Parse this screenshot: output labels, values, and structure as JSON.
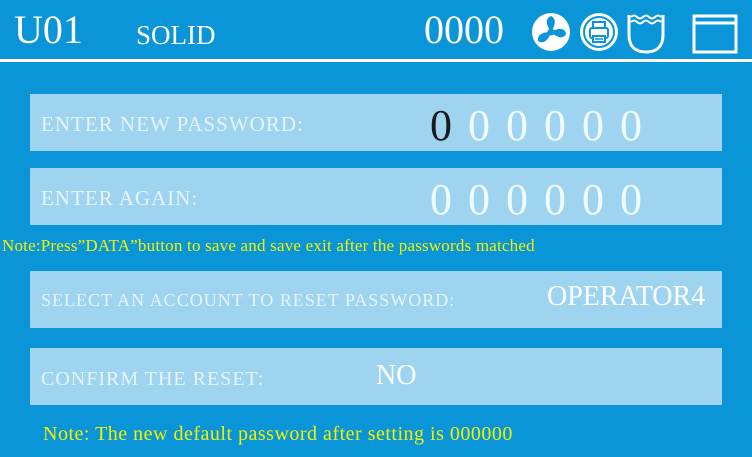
{
  "header": {
    "unit_id": "U01",
    "mode": "SOLID",
    "counter": "0000",
    "icons": [
      "fan-icon",
      "printer-icon",
      "water-bath-icon",
      "window-icon"
    ]
  },
  "new_password": {
    "label": "ENTER NEW PASSWORD:",
    "digits": [
      "0",
      "0",
      "0",
      "0",
      "0",
      "0"
    ],
    "active_index": 0
  },
  "again_password": {
    "label": "ENTER AGAIN:",
    "digits": [
      "0",
      "0",
      "0",
      "0",
      "0",
      "0"
    ]
  },
  "note_save": "Note:Press”DATA”button to save and save exit after the passwords matched",
  "reset_account": {
    "label": "SELECT AN ACCOUNT TO RESET PASSWORD:",
    "value": "OPERATOR4"
  },
  "confirm_reset": {
    "label": "CONFIRM THE RESET:",
    "value": "NO"
  },
  "note_default": "Note: The new default password  after setting is 000000",
  "colors": {
    "background": "#0a95d9",
    "panel": "#9fd4f0",
    "note": "#f2f200",
    "active_digit": "#1a1a1a"
  }
}
